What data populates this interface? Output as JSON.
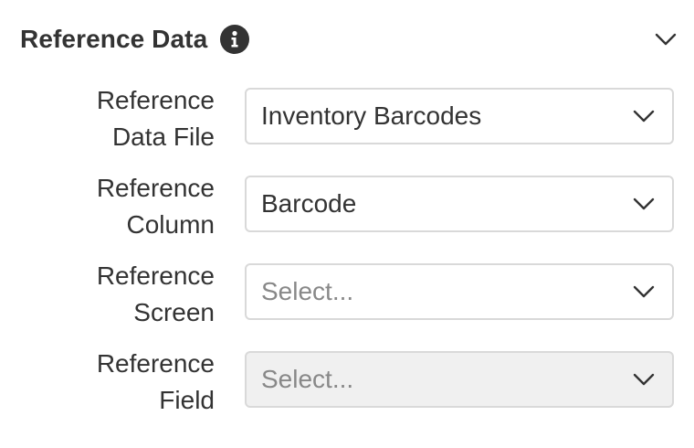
{
  "section": {
    "title": "Reference Data",
    "info_icon": "info-icon",
    "collapse_icon": "chevron-down-icon"
  },
  "fields": [
    {
      "label_line1": "Reference",
      "label_line2": "Data File",
      "value": "Inventory Barcodes",
      "placeholder": "",
      "disabled": false
    },
    {
      "label_line1": "Reference",
      "label_line2": "Column",
      "value": "Barcode",
      "placeholder": "",
      "disabled": false
    },
    {
      "label_line1": "Reference",
      "label_line2": "Screen",
      "value": "",
      "placeholder": "Select...",
      "disabled": false
    },
    {
      "label_line1": "Reference",
      "label_line2": "Field",
      "value": "",
      "placeholder": "Select...",
      "disabled": true
    }
  ],
  "colors": {
    "text": "#333333",
    "placeholder": "#888888",
    "border": "#d9d9d9",
    "disabled_bg": "#f0f0f0"
  }
}
